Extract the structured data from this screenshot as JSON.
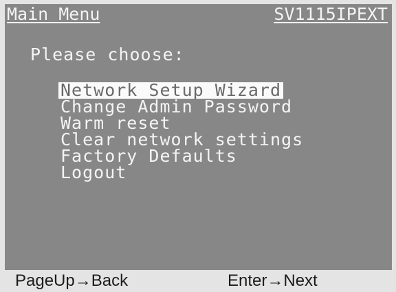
{
  "header": {
    "title": "Main Menu",
    "device": "SV1115IPEXT"
  },
  "prompt": "Please choose:",
  "menu": {
    "items": [
      {
        "label": "Network Setup Wizard",
        "selected": true
      },
      {
        "label": "Change Admin Password",
        "selected": false
      },
      {
        "label": "Warm reset",
        "selected": false
      },
      {
        "label": "Clear network settings",
        "selected": false
      },
      {
        "label": "Factory Defaults",
        "selected": false
      },
      {
        "label": "Logout",
        "selected": false
      }
    ]
  },
  "footer": {
    "back_hint": "PageUp→Back",
    "next_hint": "Enter→Next"
  },
  "colors": {
    "screen_background": "#878787",
    "text": "#f4f4f4",
    "selection_background": "#fafafa",
    "selection_text": "#6a6a6a",
    "footer_background": "#e4e4e4"
  }
}
